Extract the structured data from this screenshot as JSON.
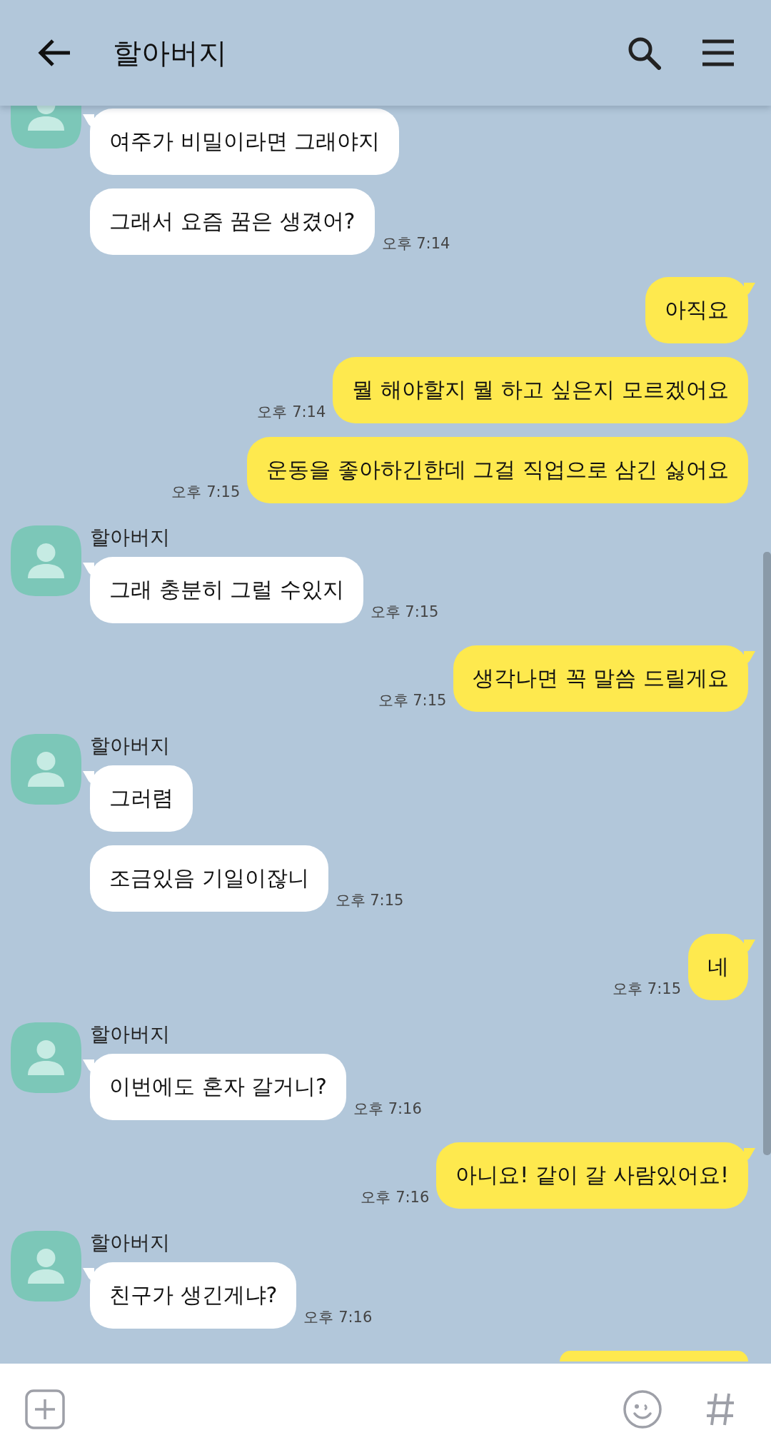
{
  "header": {
    "title": "할아버지"
  },
  "groups": [
    {
      "kind": "received",
      "bubbles": [
        {
          "text": "여주가 비밀이라면 그래야지"
        },
        {
          "text": "그래서 요즘 꿈은 생겼어?",
          "time": "오후 7:14"
        }
      ]
    },
    {
      "kind": "sent",
      "bubbles": [
        {
          "text": "아직요"
        },
        {
          "text": "뭘 해야할지 뭘 하고 싶은지 모르겠어요",
          "time": "오후 7:14"
        },
        {
          "text": "운동을 좋아하긴한데 그걸 직업으로 삼긴 싫어요",
          "time": "오후 7:15"
        }
      ]
    },
    {
      "kind": "received",
      "name": "할아버지",
      "bubbles": [
        {
          "text": "그래 충분히 그럴 수있지",
          "time": "오후 7:15"
        }
      ]
    },
    {
      "kind": "sent",
      "bubbles": [
        {
          "text": "생각나면 꼭 말씀 드릴게요",
          "time": "오후 7:15"
        }
      ]
    },
    {
      "kind": "received",
      "name": "할아버지",
      "bubbles": [
        {
          "text": "그러렴"
        },
        {
          "text": "조금있음 기일이잖니",
          "time": "오후 7:15"
        }
      ]
    },
    {
      "kind": "sent",
      "bubbles": [
        {
          "text": "네",
          "time": "오후 7:15"
        }
      ]
    },
    {
      "kind": "received",
      "name": "할아버지",
      "bubbles": [
        {
          "text": "이번에도 혼자 갈거니?",
          "time": "오후 7:16"
        }
      ]
    },
    {
      "kind": "sent",
      "bubbles": [
        {
          "text": "아니요! 같이 갈 사람있어요!",
          "time": "오후 7:16"
        }
      ]
    },
    {
      "kind": "received",
      "name": "할아버지",
      "bubbles": [
        {
          "text": "친구가 생긴게냐?",
          "time": "오후 7:16"
        }
      ]
    },
    {
      "kind": "sent",
      "bubbles": [
        {
          "kind": "partial"
        }
      ]
    }
  ]
}
